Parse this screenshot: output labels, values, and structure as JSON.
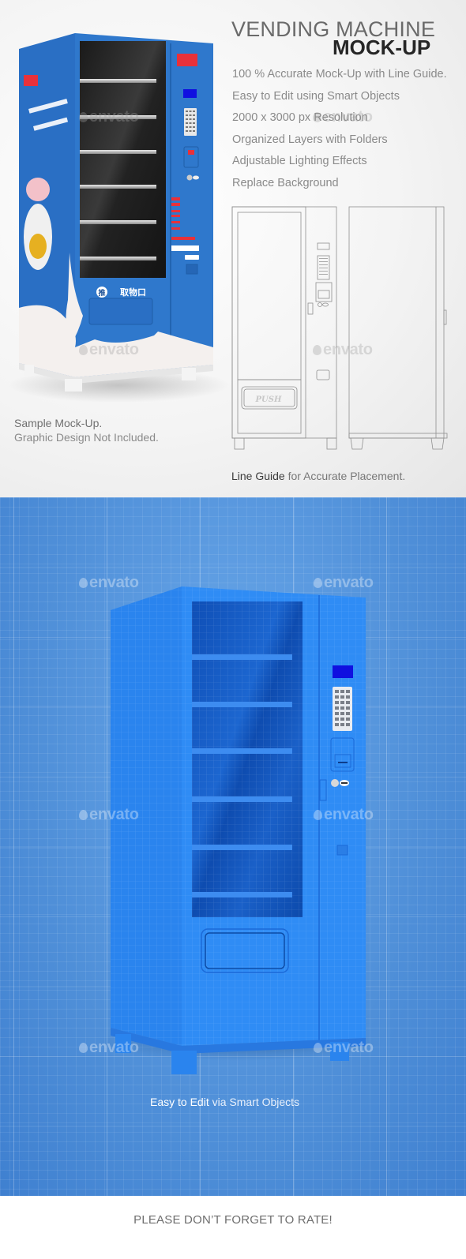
{
  "header": {
    "title_line1": "VENDING MACHINE",
    "title_line2": "MOCK-UP"
  },
  "features": [
    "100 % Accurate Mock-Up with Line Guide.",
    "Easy to Edit using Smart Objects",
    "2000 x 3000 px Resolution",
    "Organized Layers with Folders",
    "Adjustable Lighting Effects",
    "Replace Background"
  ],
  "sample": {
    "line1": "Sample Mock-Up.",
    "line2": "Graphic Design Not Included.",
    "machine_labels": {
      "push_badge": "推",
      "pickup_label": "取物口"
    }
  },
  "line_guide": {
    "bold": "Line Guide",
    "rest": " for Accurate Placement.",
    "push_label": "PUSH"
  },
  "blue_section": {
    "caption_bold": "Easy to Edit",
    "caption_rest": " via Smart Objects"
  },
  "watermark": {
    "text": "envato",
    "icon": "envato-drop-icon"
  },
  "footer": {
    "rate_text": "PLEASE DON’T FORGET TO RATE!"
  },
  "colors": {
    "machine_blue": "#2a72c8",
    "blueprint_bg": "#4f8fd8",
    "display_blue": "#1010e0",
    "logo_red": "#e8313a"
  }
}
